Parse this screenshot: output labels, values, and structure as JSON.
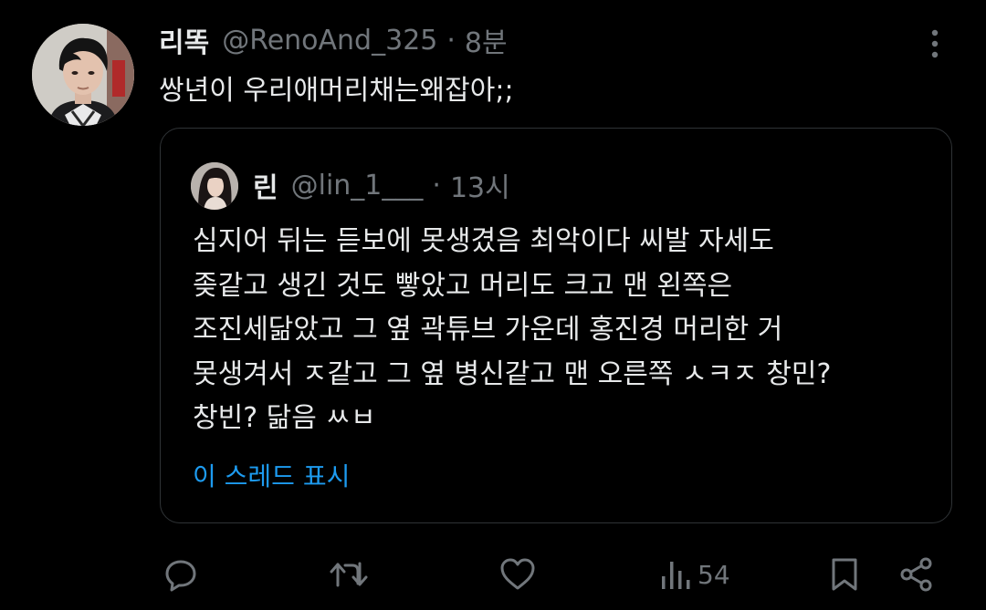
{
  "tweet": {
    "display_name": "리똑",
    "handle": "@RenoAnd_325",
    "separator": "·",
    "time": "8분",
    "avatar_icon": "user-photo-avatar",
    "more_icon": "more-vertical-icon",
    "text": "쌍년이 우리애머리채는왜잡아;;"
  },
  "quote": {
    "display_name": "린",
    "handle": "@lin_1___",
    "separator": "·",
    "time": "13시",
    "avatar_icon": "user-photo-avatar",
    "text": "심지어 뒤는 듣보에 못생겼음 최악이다 씨발 자세도\n좆같고 생긴 것도 빻았고 머리도 크고 맨 왼쪽은\n조진세닮았고 그 옆 곽튜브 가운데 홍진경 머리한 거\n못생겨서 ㅈ같고 그 옆 병신같고 맨 오른쪽 ㅅㅋㅈ 창민?\n창빈? 닮음 ㅆㅂ",
    "show_thread": "이 스레드 표시"
  },
  "actions": {
    "reply_icon": "reply-icon",
    "retweet_icon": "retweet-icon",
    "like_icon": "heart-icon",
    "views_icon": "views-chart-icon",
    "views_count": "54",
    "bookmark_icon": "bookmark-icon",
    "share_icon": "share-icon"
  },
  "colors": {
    "background": "#000000",
    "text_primary": "#e7e9ea",
    "text_secondary": "#71767b",
    "link": "#1d9bf0",
    "border": "#2f3336"
  }
}
